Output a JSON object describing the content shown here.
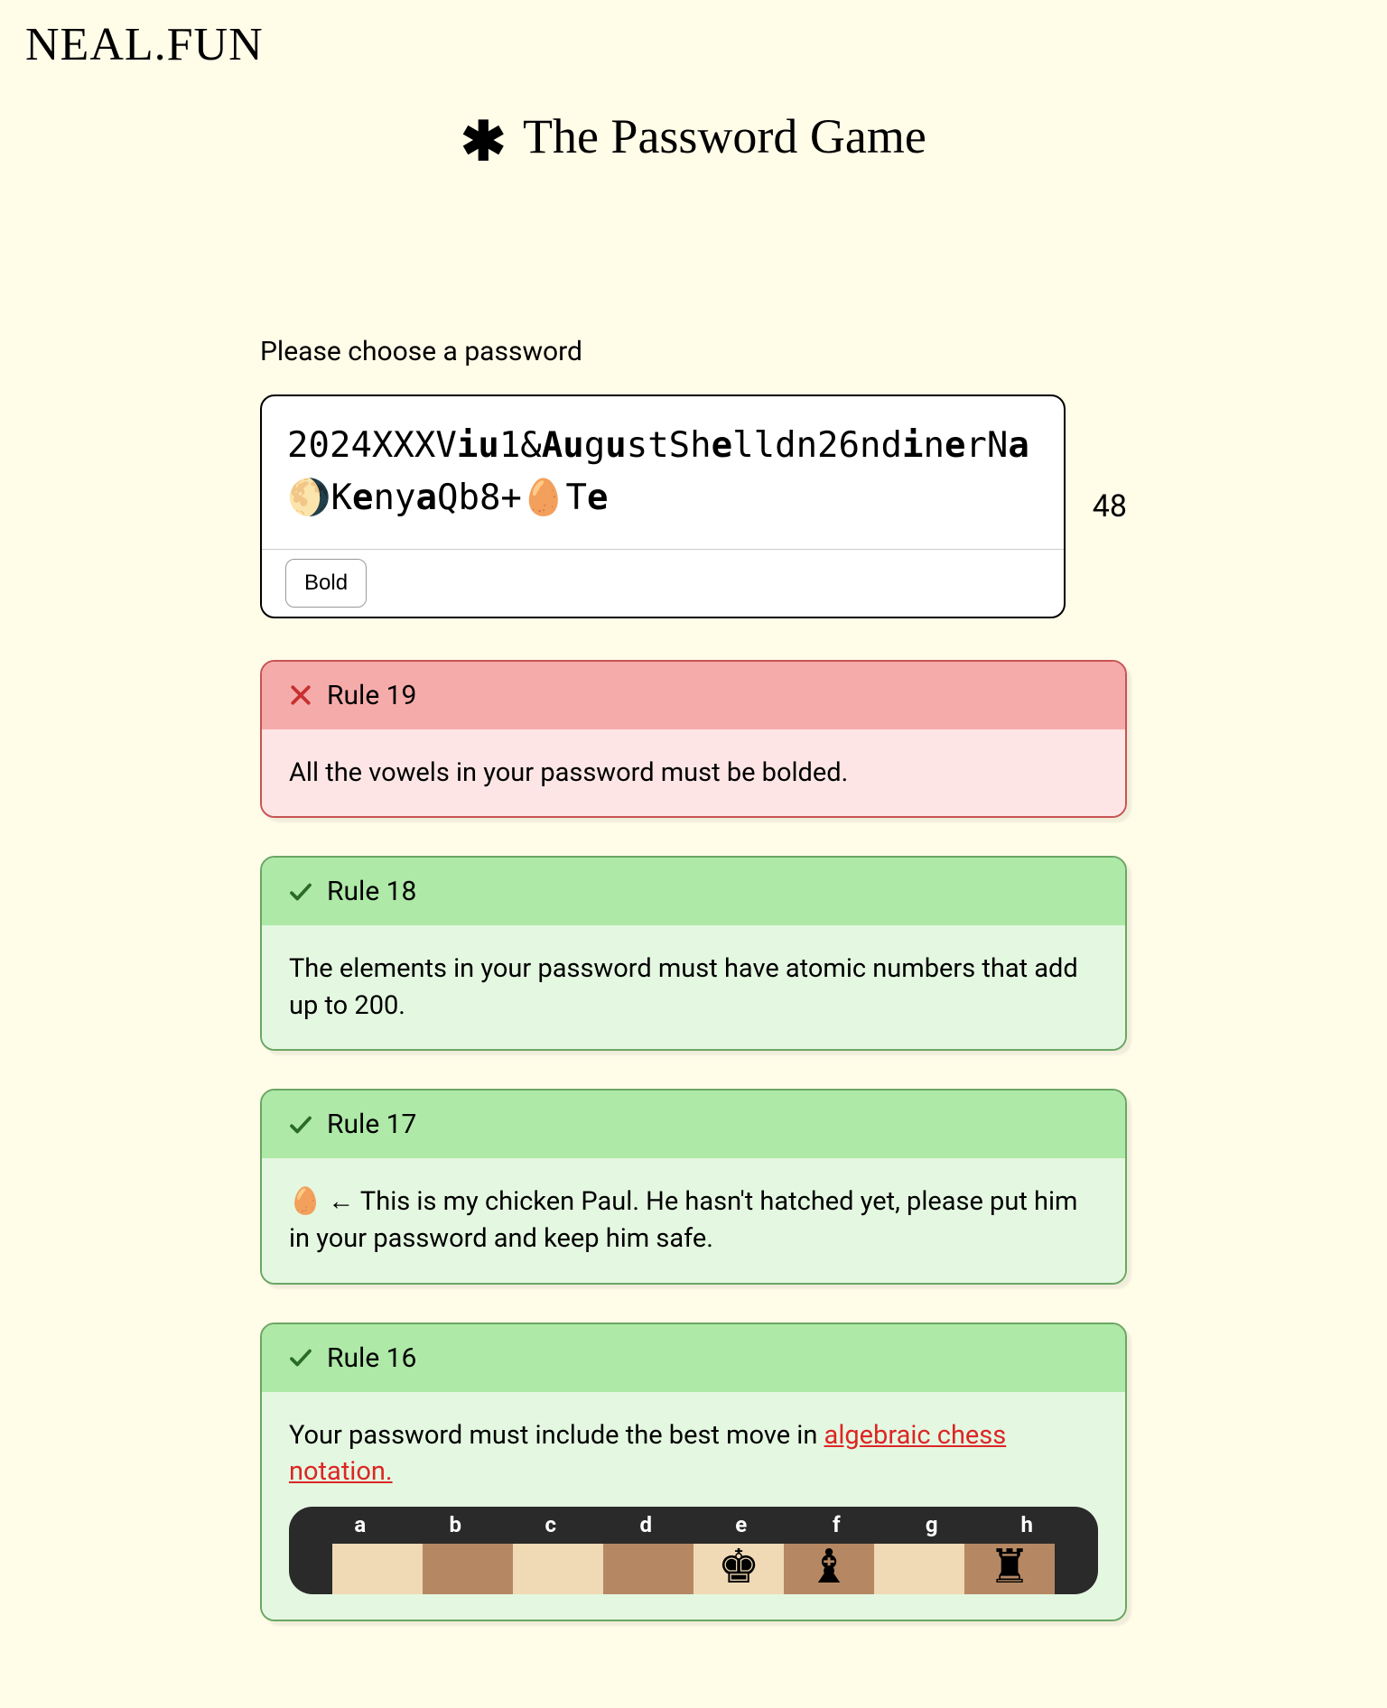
{
  "logo": "NEAL.FUN",
  "title": "The Password Game",
  "prompt": "Please choose a password",
  "password_segments": [
    {
      "text": "2024XXXV",
      "bold": false
    },
    {
      "text": "iu",
      "bold": true
    },
    {
      "text": "1&",
      "bold": false
    },
    {
      "text": "Au",
      "bold": true
    },
    {
      "text": "g",
      "bold": false
    },
    {
      "text": "u",
      "bold": true
    },
    {
      "text": "stSh",
      "bold": false
    },
    {
      "text": "e",
      "bold": true
    },
    {
      "text": "lldn26nd",
      "bold": false
    },
    {
      "text": "i",
      "bold": true
    },
    {
      "text": "n",
      "bold": false
    },
    {
      "text": "e",
      "bold": true
    },
    {
      "text": "rN",
      "bold": false
    },
    {
      "text": "a",
      "bold": true
    },
    {
      "text": "🌖K",
      "bold": false
    },
    {
      "text": "e",
      "bold": true
    },
    {
      "text": "ny",
      "bold": false
    },
    {
      "text": "a",
      "bold": true
    },
    {
      "text": "Qb8+🥚T",
      "bold": false
    },
    {
      "text": "e",
      "bold": true
    }
  ],
  "counter": "48",
  "toolbar": {
    "bold_label": "Bold"
  },
  "rules": [
    {
      "id": 19,
      "label": "Rule 19",
      "pass": false,
      "text": "All the vowels in your password must be bolded."
    },
    {
      "id": 18,
      "label": "Rule 18",
      "pass": true,
      "text": "The elements in your password must have atomic numbers that add up to 200."
    },
    {
      "id": 17,
      "label": "Rule 17",
      "pass": true,
      "text": "🥚 ← This is my chicken Paul. He hasn't hatched yet, please put him in your password and keep him safe."
    },
    {
      "id": 16,
      "label": "Rule 16",
      "pass": true,
      "text_prefix": "Your password must include the best move in ",
      "link_text": "algebraic chess notation.",
      "chess_files": [
        "a",
        "b",
        "c",
        "d",
        "e",
        "f",
        "g",
        "h"
      ]
    }
  ]
}
